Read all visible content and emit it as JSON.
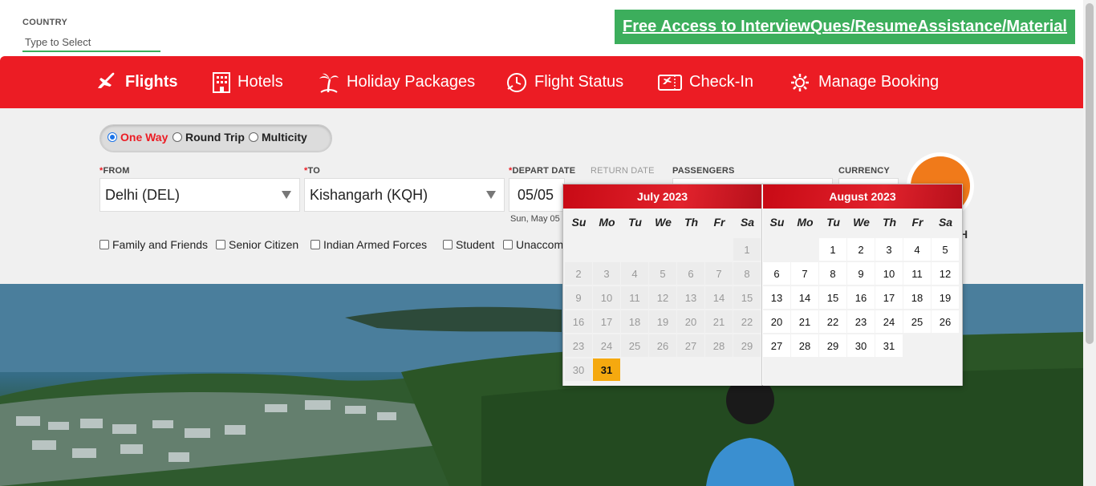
{
  "top": {
    "country_label": "COUNTRY",
    "country_placeholder": "Type to Select",
    "promo_link": "Free Access to InterviewQues/ResumeAssistance/Material"
  },
  "nav": {
    "items": [
      {
        "label": "Flights",
        "icon": "airplane-icon"
      },
      {
        "label": "Hotels",
        "icon": "hotel-icon"
      },
      {
        "label": "Holiday Packages",
        "icon": "palm-tree-icon"
      },
      {
        "label": "Flight Status",
        "icon": "flight-status-icon"
      },
      {
        "label": "Check-In",
        "icon": "ticket-icon"
      },
      {
        "label": "Manage Booking",
        "icon": "gear-icon"
      }
    ]
  },
  "trip_type": {
    "options": [
      "One Way",
      "Round Trip",
      "Multicity"
    ],
    "selected": "One Way"
  },
  "form": {
    "from_label": "FROM",
    "from_value": "Delhi (DEL)",
    "to_label": "TO",
    "to_value": "Kishangarh (KQH)",
    "depart_label": "DEPART DATE",
    "depart_value": "05/05",
    "depart_sub": "Sun, May 05",
    "return_label": "RETURN DATE",
    "passengers_label": "PASSENGERS",
    "currency_label": "CURRENCY",
    "search_partial": "H"
  },
  "discounts": [
    "Family and Friends",
    "Senior Citizen",
    "Indian Armed Forces",
    "Student",
    "Unaccom"
  ],
  "calendar": {
    "weekdays": [
      "Su",
      "Mo",
      "Tu",
      "We",
      "Th",
      "Fr",
      "Sa"
    ],
    "months": [
      {
        "title": "July 2023",
        "days": [
          "1",
          "2",
          "3",
          "4",
          "5",
          "6",
          "7",
          "8",
          "9",
          "10",
          "11",
          "12",
          "13",
          "14",
          "15",
          "16",
          "17",
          "18",
          "19",
          "20",
          "21",
          "22",
          "23",
          "24",
          "25",
          "26",
          "27",
          "28",
          "29",
          "30",
          "31"
        ],
        "highlighted": "31"
      },
      {
        "title": "August 2023",
        "days": [
          "1",
          "2",
          "3",
          "4",
          "5",
          "6",
          "7",
          "8",
          "9",
          "10",
          "11",
          "12",
          "13",
          "14",
          "15",
          "16",
          "17",
          "18",
          "19",
          "20",
          "21",
          "22",
          "23",
          "24",
          "25",
          "26",
          "27",
          "28",
          "29",
          "30",
          "31"
        ]
      }
    ]
  },
  "colors": {
    "brand_red": "#ec1c24",
    "promo_green": "#3cae5c",
    "highlight": "#f5a90f",
    "search_orange": "#f07a1a"
  }
}
